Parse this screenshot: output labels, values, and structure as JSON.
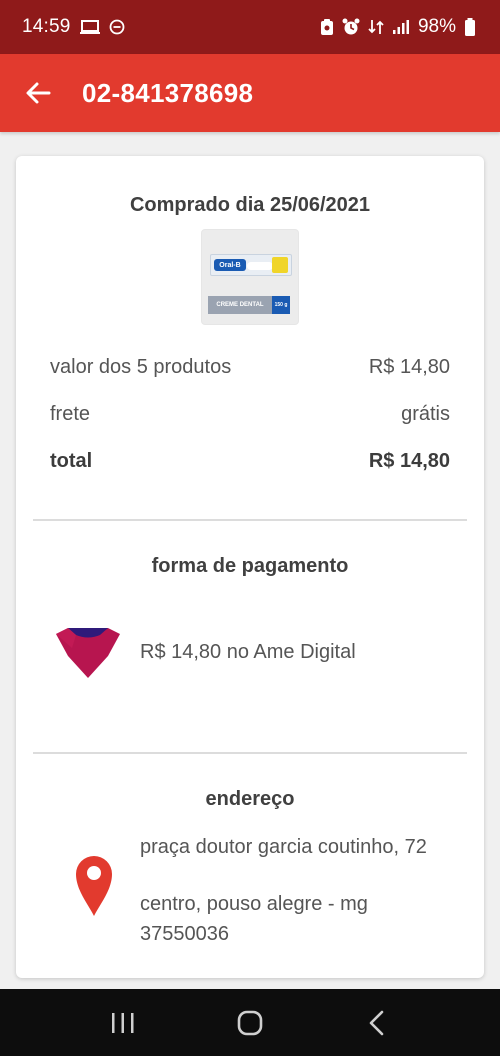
{
  "status_bar": {
    "time": "14:59",
    "battery": "98%",
    "background": "#8f1a1a"
  },
  "header": {
    "title": "02-841378698",
    "back_icon": "arrow-left-icon",
    "background": "#e23a2e"
  },
  "order": {
    "purchase_date_label": "Comprado dia 25/06/2021",
    "product_image_text": {
      "brand": "Oral-B",
      "label": "CREME DENTAL",
      "weight": "150 g"
    },
    "summary": [
      {
        "label": "valor dos 5 produtos",
        "value": "R$ 14,80"
      },
      {
        "label": "frete",
        "value": "grátis"
      },
      {
        "label": "total",
        "value": "R$ 14,80"
      }
    ]
  },
  "payment": {
    "title": "forma de pagamento",
    "icon": "ame-digital-icon",
    "text": "R$ 14,80 no Ame Digital"
  },
  "address": {
    "title": "endereço",
    "icon": "location-pin-icon",
    "street": "praça doutor garcia coutinho, 72",
    "city": "centro, pouso alegre - mg",
    "zip": "37550036"
  },
  "nav_bar": {
    "buttons": [
      "recent-apps-icon",
      "home-icon",
      "back-icon"
    ]
  }
}
